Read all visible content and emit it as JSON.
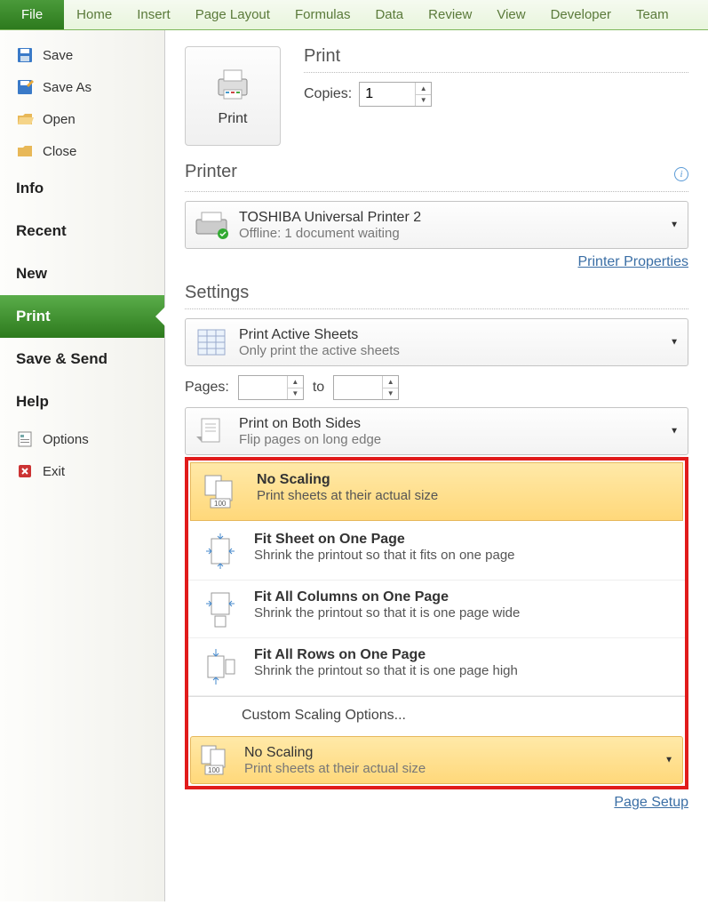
{
  "ribbon": {
    "file": "File",
    "tabs": [
      "Home",
      "Insert",
      "Page Layout",
      "Formulas",
      "Data",
      "Review",
      "View",
      "Developer",
      "Team"
    ]
  },
  "sidebar": {
    "save": "Save",
    "save_as": "Save As",
    "open": "Open",
    "close": "Close",
    "info": "Info",
    "recent": "Recent",
    "new": "New",
    "print": "Print",
    "save_send": "Save & Send",
    "help": "Help",
    "options": "Options",
    "exit": "Exit"
  },
  "print": {
    "button": "Print",
    "title": "Print",
    "copies_label": "Copies:",
    "copies_value": "1",
    "printer_title": "Printer",
    "printer_name": "TOSHIBA Universal Printer 2",
    "printer_status": "Offline: 1 document waiting",
    "printer_props": "Printer Properties",
    "settings_title": "Settings",
    "active_sheets_title": "Print Active Sheets",
    "active_sheets_desc": "Only print the active sheets",
    "pages_label": "Pages:",
    "to_label": "to",
    "both_sides_title": "Print on Both Sides",
    "both_sides_desc": "Flip pages on long edge",
    "scaling": {
      "options": [
        {
          "title": "No Scaling",
          "desc": "Print sheets at their actual size"
        },
        {
          "title": "Fit Sheet on One Page",
          "desc": "Shrink the printout so that it fits on one page"
        },
        {
          "title": "Fit All Columns on One Page",
          "desc": "Shrink the printout so that it is one page wide"
        },
        {
          "title": "Fit All Rows on One Page",
          "desc": "Shrink the printout so that it is one page high"
        }
      ],
      "custom": "Custom Scaling Options...",
      "current_title": "No Scaling",
      "current_desc": "Print sheets at their actual size"
    },
    "page_setup": "Page Setup"
  }
}
